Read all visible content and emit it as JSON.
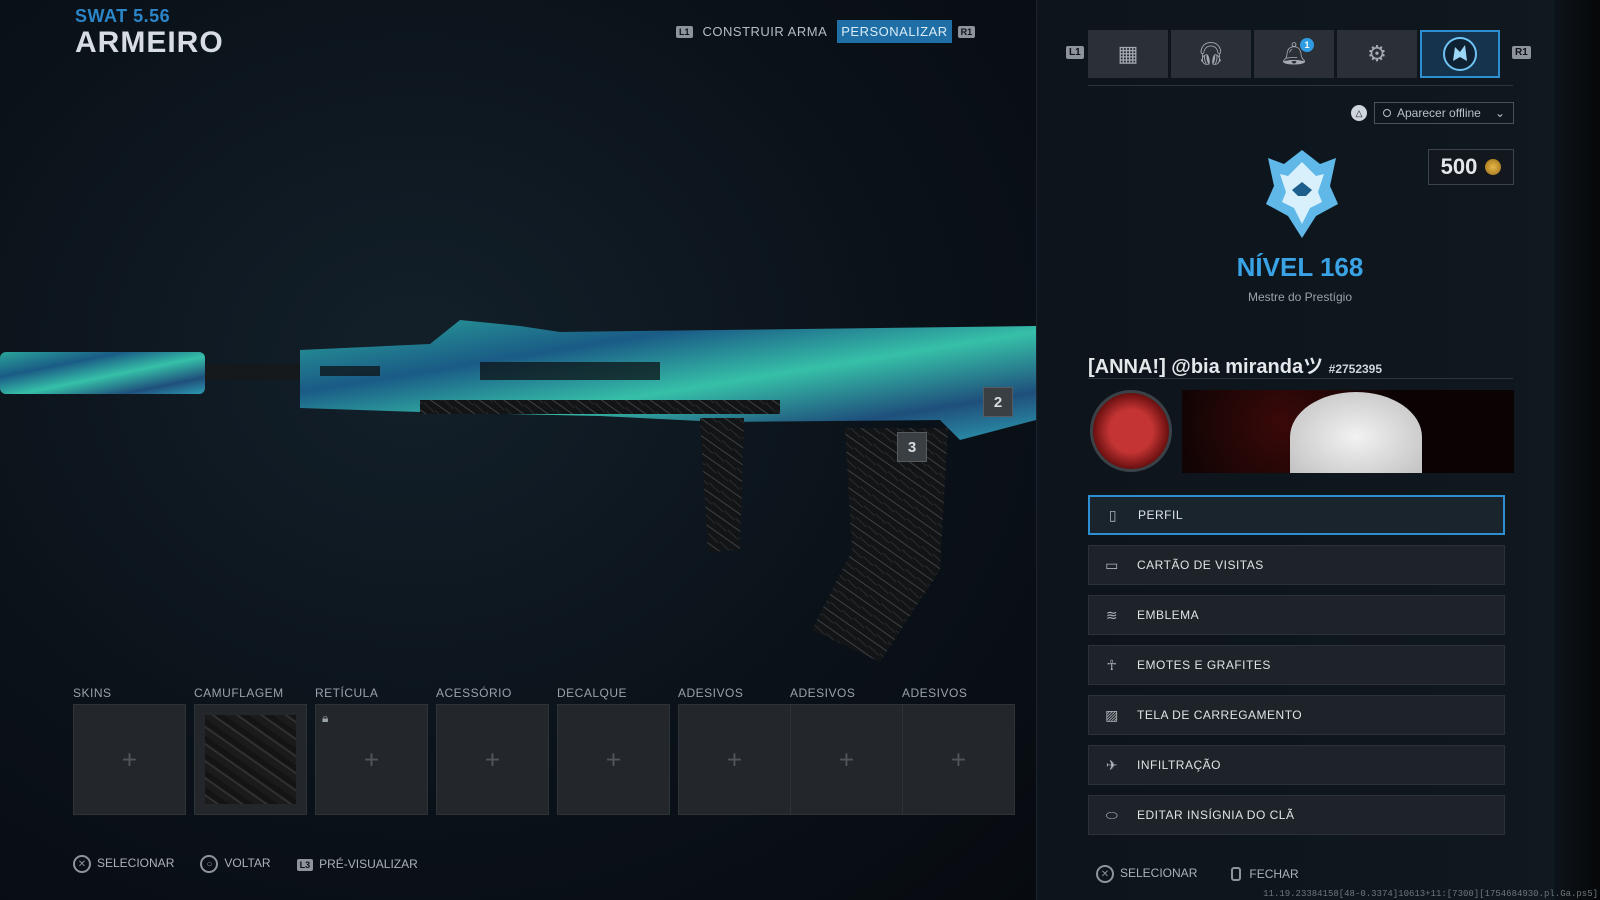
{
  "header": {
    "weapon_name": "SWAT 5.56",
    "title": "ARMEIRO",
    "tab_left_glyph": "L1",
    "tab_right_glyph": "R1",
    "tabs": [
      {
        "label": "CONSTRUIR ARMA",
        "active": false
      },
      {
        "label": "PERSONALIZAR",
        "active": true
      }
    ]
  },
  "weapon": {
    "tags": [
      "2",
      "3"
    ],
    "accent_colors": [
      "#1c6a70",
      "#3bb0a3",
      "#1b4e7c"
    ]
  },
  "slots": [
    {
      "label": "SKINS",
      "state": "empty"
    },
    {
      "label": "CAMUFLAGEM",
      "state": "equipped"
    },
    {
      "label": "RETÍCULA",
      "state": "locked"
    },
    {
      "label": "ACESSÓRIO",
      "state": "empty"
    },
    {
      "label": "DECALQUE",
      "state": "empty"
    },
    {
      "label": "ADESIVOS",
      "state": "empty"
    },
    {
      "label": "ADESIVOS",
      "state": "empty"
    },
    {
      "label": "ADESIVOS",
      "state": "empty"
    }
  ],
  "footer_left": {
    "select": "SELECIONAR",
    "back": "VOLTAR",
    "preview": "PRÉ-VISUALIZAR",
    "preview_glyph": "L3"
  },
  "topbar": {
    "left_glyph": "L1",
    "right_glyph": "R1",
    "buttons": [
      {
        "icon": "grid-icon"
      },
      {
        "icon": "headset-icon"
      },
      {
        "icon": "bell-icon",
        "badge": "1"
      },
      {
        "icon": "gear-icon"
      },
      {
        "icon": "profile-emblem-icon",
        "active": true
      }
    ]
  },
  "status": {
    "label": "Aparecer offline"
  },
  "currency": {
    "amount": "500"
  },
  "profile": {
    "level": "NÍVEL 168",
    "rank_title": "Mestre do Prestígio",
    "player_name": "[ANNA!] @bia mirandaツ",
    "player_id": "#2752395"
  },
  "menu": [
    {
      "label": "PERFIL",
      "icon": "profile-icon",
      "active": true
    },
    {
      "label": "CARTÃO DE VISITAS",
      "icon": "calling-card-icon"
    },
    {
      "label": "EMBLEMA",
      "icon": "emblem-icon"
    },
    {
      "label": "EMOTES E GRAFITES",
      "icon": "emote-icon"
    },
    {
      "label": "TELA DE CARREGAMENTO",
      "icon": "loading-screen-icon"
    },
    {
      "label": "INFILTRAÇÃO",
      "icon": "infil-icon"
    },
    {
      "label": "EDITAR INSÍGNIA DO CLÃ",
      "icon": "clan-tag-icon"
    }
  ],
  "footer_right": {
    "select": "SELECIONAR",
    "close": "FECHAR"
  },
  "debug_text": "11.19.23384158[48-0.3374]10613+11:[7300][1754684930.pl.Ga.ps5]"
}
